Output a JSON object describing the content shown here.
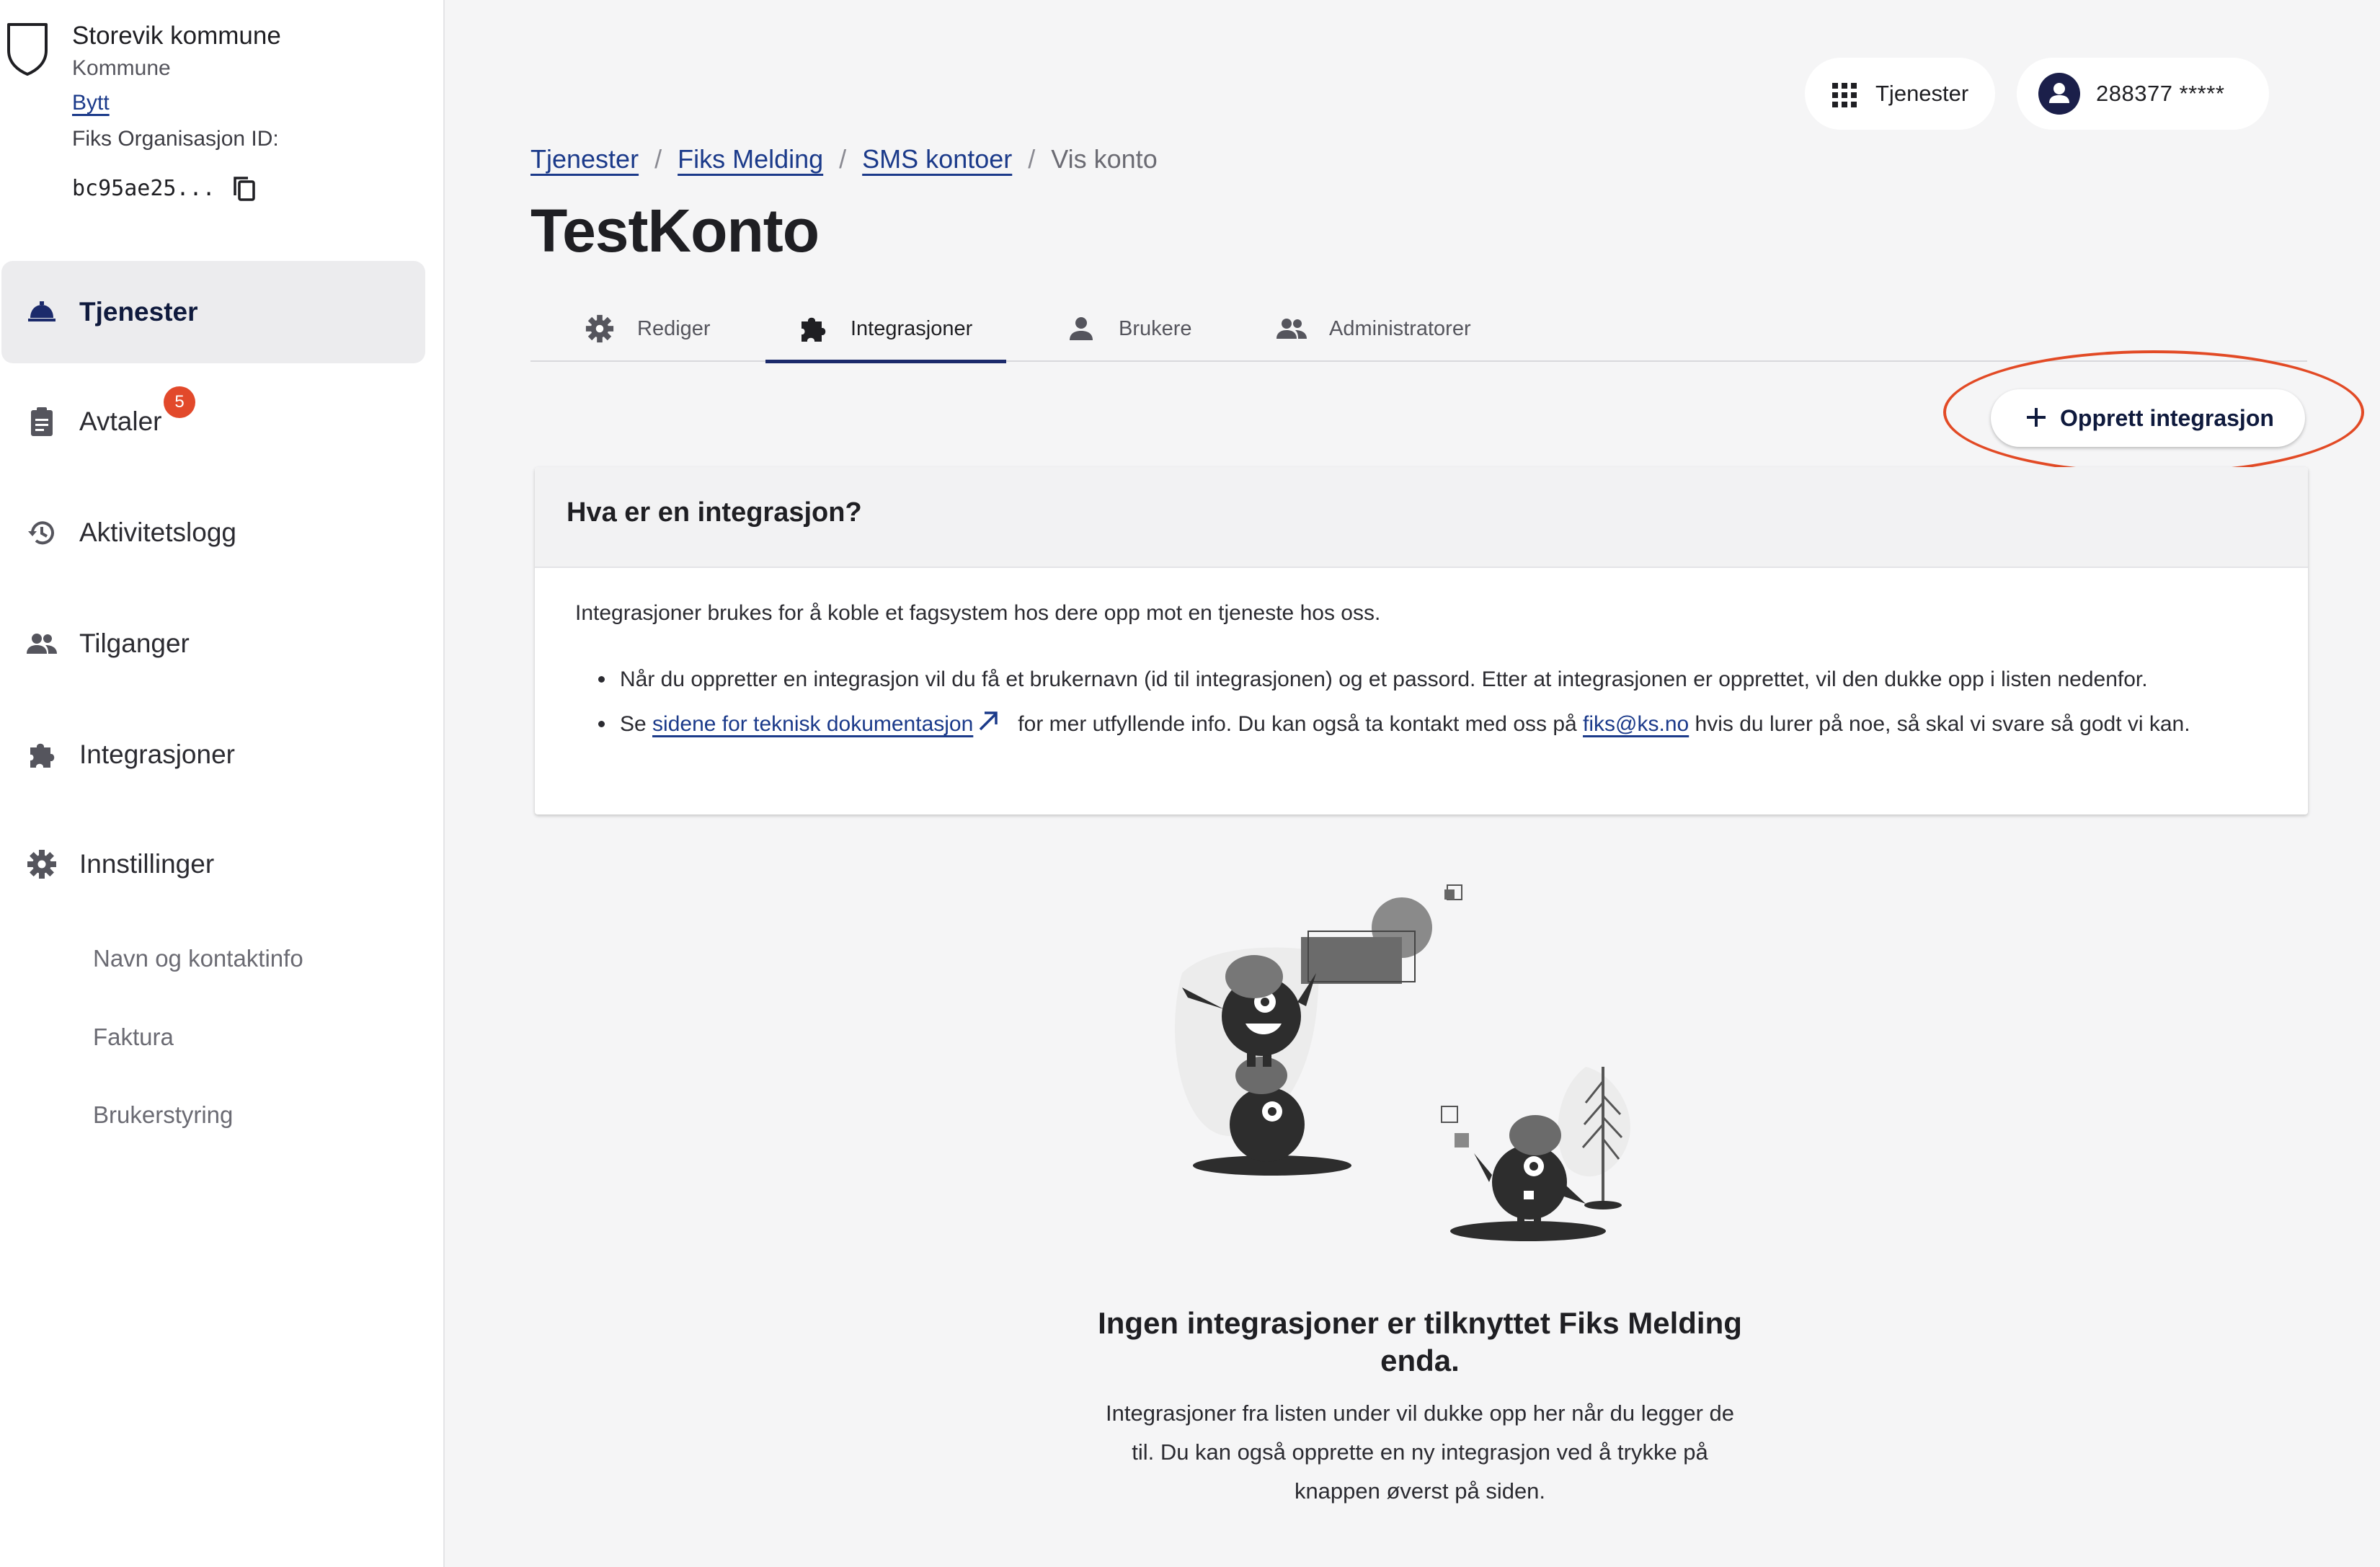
{
  "org": {
    "name": "Storevik kommune",
    "type": "Kommune",
    "switch_label": "Bytt",
    "id_label": "Fiks Organisasjon ID:",
    "id_value": "bc95ae25..."
  },
  "sidebar": {
    "items": [
      {
        "label": "Tjenester",
        "icon": "service-bell-icon",
        "active": true
      },
      {
        "label": "Avtaler",
        "icon": "clipboard-icon",
        "badge": "5"
      },
      {
        "label": "Aktivitetslogg",
        "icon": "history-icon"
      },
      {
        "label": "Tilganger",
        "icon": "people-icon"
      },
      {
        "label": "Integrasjoner",
        "icon": "puzzle-icon"
      },
      {
        "label": "Innstillinger",
        "icon": "gear-icon"
      }
    ],
    "sub_items": [
      "Navn og kontaktinfo",
      "Faktura",
      "Brukerstyring"
    ]
  },
  "topbar": {
    "services_label": "Tjenester",
    "user_label": "288377 *****"
  },
  "breadcrumb": {
    "items": [
      "Tjenester",
      "Fiks Melding",
      "SMS kontoer"
    ],
    "current": "Vis konto",
    "separator": "/"
  },
  "page": {
    "title": "TestKonto"
  },
  "tabs": [
    {
      "label": "Rediger",
      "icon": "gear-icon"
    },
    {
      "label": "Integrasjoner",
      "icon": "puzzle-icon",
      "active": true
    },
    {
      "label": "Brukere",
      "icon": "person-icon"
    },
    {
      "label": "Administratorer",
      "icon": "people-icon"
    }
  ],
  "actions": {
    "create_label": "Opprett integrasjon"
  },
  "info_card": {
    "title": "Hva er en integrasjon?",
    "intro": "Integrasjoner brukes for å koble et fagsystem hos dere opp mot en tjeneste hos oss.",
    "bullet1": "Når du oppretter en integrasjon vil du få et brukernavn (id til integrasjonen) og et passord. Etter at integrasjonen er opprettet, vil den dukke opp i listen nedenfor.",
    "bullet2_prefix": "Se ",
    "bullet2_link": "sidene for teknisk dokumentasjon",
    "bullet2_middle": "for mer utfyllende info. Du kan også ta kontakt med oss på ",
    "bullet2_email": "fiks@ks.no",
    "bullet2_suffix": " hvis du lurer på noe, så skal vi svare så godt vi kan."
  },
  "empty_state": {
    "title": "Ingen integrasjoner er tilknyttet Fiks Melding enda.",
    "text": "Integrasjoner fra listen under vil dukke opp her når du legger de til. Du kan også opprette en ny integrasjon ved å trykke på knappen øverst på siden."
  },
  "colors": {
    "accent": "#1b3a8a",
    "active_nav_bg": "#ececee",
    "badge": "#e2492b",
    "annotation": "#e24a25",
    "page_bg": "#f5f5f6"
  }
}
